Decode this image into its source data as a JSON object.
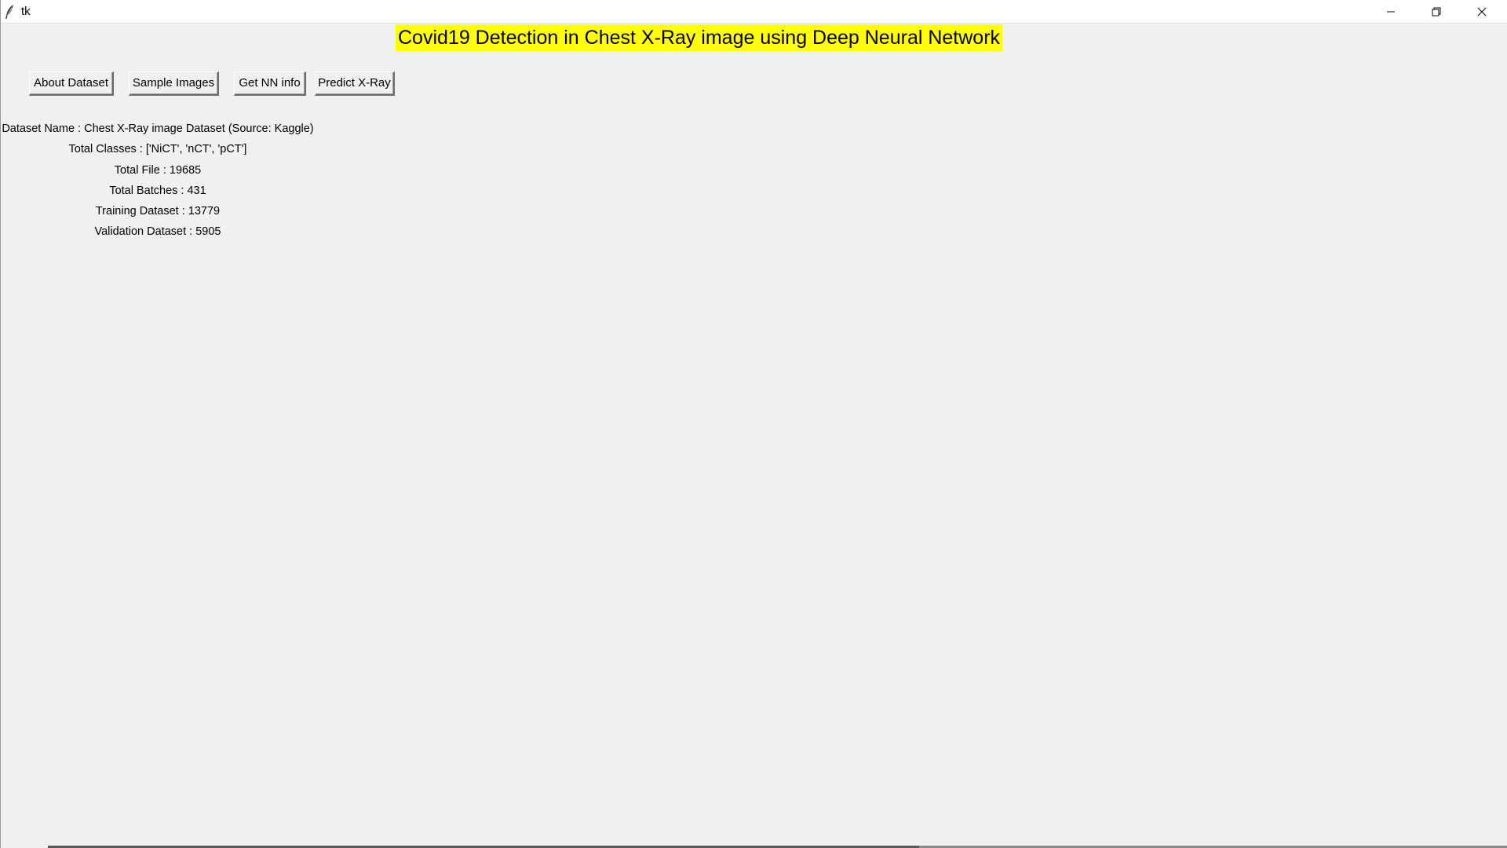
{
  "window": {
    "title": "tk"
  },
  "heading": {
    "text": "Covid19 Detection in Chest X-Ray image using Deep Neural Network",
    "background": "#ffff00"
  },
  "toolbar": {
    "about_label": "About Dataset",
    "sample_label": "Sample Images",
    "nninfo_label": "Get NN info",
    "predict_label": "Predict X-Ray"
  },
  "dataset_info": {
    "name": "Dataset Name : Chest X-Ray image Dataset (Source: Kaggle)",
    "classes": "Total Classes : ['NiCT', 'nCT', 'pCT']",
    "files": "Total File : 19685",
    "batches": "Total Batches : 431",
    "training": "Training Dataset : 13779",
    "validation": "Validation Dataset : 5905"
  },
  "icons": {
    "app": "tk-feather-icon",
    "minimize": "minimize-icon",
    "maximize": "restore-icon",
    "close": "close-icon"
  }
}
